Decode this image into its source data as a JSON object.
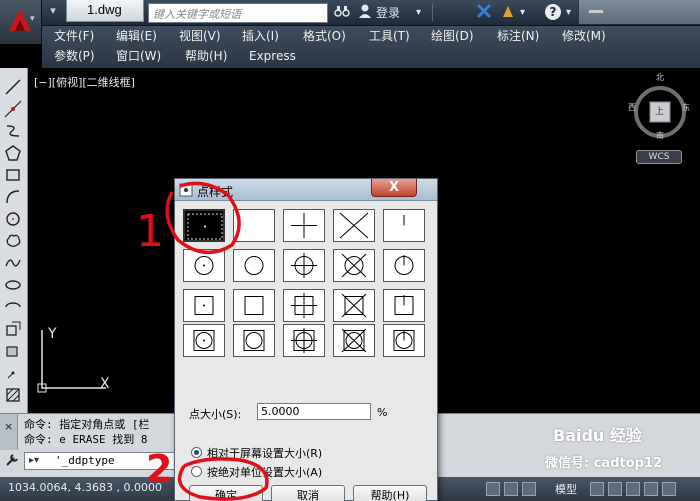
{
  "titlebar": {
    "doc_tab": "1.dwg",
    "search_placeholder": "键入关键字或短语",
    "login": "登录"
  },
  "menubar": {
    "row1": [
      "文件(F)",
      "编辑(E)",
      "视图(V)",
      "插入(I)",
      "格式(O)",
      "工具(T)",
      "绘图(D)",
      "标注(N)",
      "修改(M)"
    ],
    "row2": [
      "参数(P)",
      "窗口(W)",
      "帮助(H)",
      "Express"
    ]
  },
  "canvas": {
    "view_label": "[−][俯视][二维线框]",
    "compass": {
      "north": "北",
      "south": "南",
      "west": "西",
      "east": "东",
      "center": "上"
    },
    "wcs": "WCS",
    "ucs_x": "X",
    "ucs_y": "Y"
  },
  "command": {
    "line1": "命令: 指定对角点或 [栏",
    "line2": "命令: e ERASE 找到 8",
    "input": "'_ddptype"
  },
  "statusbar": {
    "coords": "1034.0064,  4.3683 ,  0.0000",
    "model": "模型"
  },
  "dialog": {
    "title": "点样式",
    "close": "X",
    "size_label": "点大小(S):",
    "size_value": "5.0000",
    "size_unit": "%",
    "radio1": "相对于屏幕设置大小(R)",
    "radio2": "按绝对单位设置大小(A)",
    "radio_selected": 1,
    "ok": "确定",
    "cancel": "取消",
    "help": "帮助(H)"
  },
  "annotations": {
    "mark1": "1",
    "mark2": "2"
  },
  "watermark": {
    "line1": "Baidu 经验",
    "line2": "微信号: cadtop12"
  },
  "colors": {
    "accent_red": "#e0101a",
    "canvas_bg": "#000000",
    "dialog_bg": "#e8e8e8"
  }
}
